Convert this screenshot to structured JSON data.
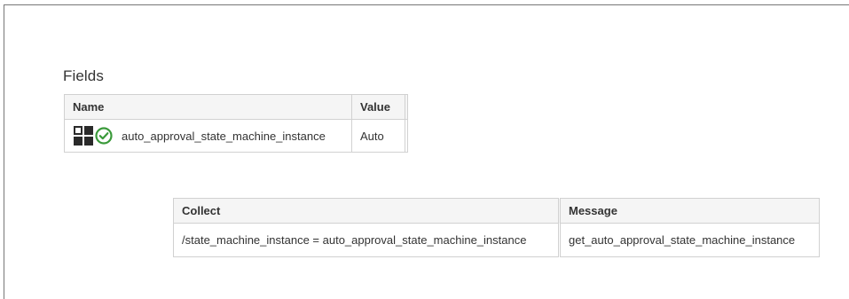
{
  "fields_section": {
    "title": "Fields",
    "columns": [
      "Name",
      "Value"
    ],
    "rows": [
      {
        "name": "auto_approval_state_machine_instance",
        "value": "Auto",
        "icons": [
          "state-grid-icon",
          "check-circle-icon"
        ]
      }
    ]
  },
  "collect_table": {
    "columns": [
      "Collect",
      "Message"
    ],
    "rows": [
      {
        "collect": "/state_machine_instance = auto_approval_state_machine_instance",
        "message": "get_auto_approval_state_machine_instance"
      }
    ]
  },
  "colors": {
    "check_green": "#3a9a3a",
    "header_bg": "#f5f5f5",
    "border": "#d1d1d1"
  }
}
